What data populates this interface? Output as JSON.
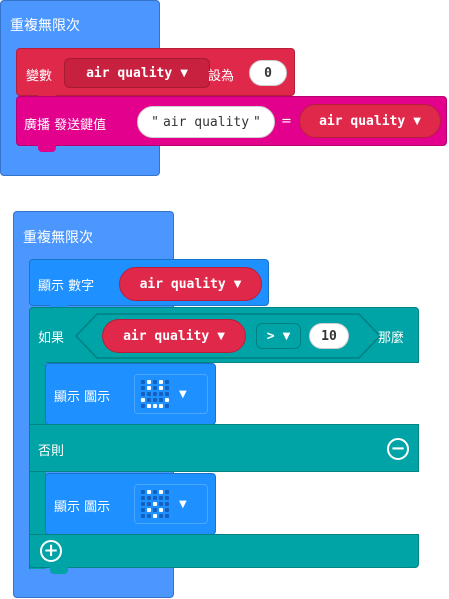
{
  "script1": {
    "loop_label": "重複無限次",
    "set_block": {
      "label": "變數",
      "variable": "air quality",
      "to_label": "設為",
      "value": "0"
    },
    "radio_block": {
      "label": "廣播 發送鍵值",
      "key": "air quality",
      "equals": "=",
      "variable": "air quality"
    }
  },
  "script2": {
    "loop_label": "重複無限次",
    "show_number": {
      "label": "顯示 數字",
      "variable": "air quality"
    },
    "if_block": {
      "if_label": "如果",
      "variable": "air quality",
      "operator": ">",
      "compare_value": "10",
      "then_label": "那麼",
      "else_label": "否則"
    },
    "show_icon_then": {
      "label": "顯示 圖示",
      "icon_name": "happy-face"
    },
    "show_icon_else": {
      "label": "顯示 圖示",
      "icon_name": "surprised-face"
    }
  },
  "icons": {
    "dropdown": "▼",
    "remove": "−",
    "add": "+"
  },
  "colors": {
    "loop": "#4c97ff",
    "variables": "#e0284a",
    "radio": "#e3008c",
    "basic": "#1e90ff",
    "logic": "#00a4a6",
    "led_on": "#ffffff",
    "led_off": "#1560bd"
  },
  "led_patterns": {
    "then": [
      0,
      1,
      0,
      1,
      0,
      0,
      1,
      0,
      1,
      0,
      0,
      0,
      0,
      0,
      0,
      1,
      0,
      0,
      0,
      1,
      0,
      1,
      1,
      1,
      0
    ],
    "else": [
      0,
      1,
      0,
      1,
      0,
      0,
      0,
      0,
      0,
      0,
      0,
      0,
      1,
      0,
      0,
      0,
      1,
      0,
      1,
      0,
      0,
      0,
      1,
      0,
      0
    ]
  }
}
